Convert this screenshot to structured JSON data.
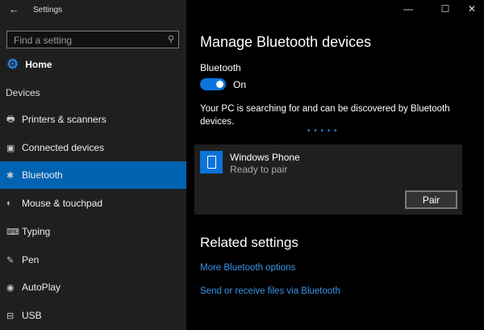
{
  "window": {
    "title": "Settings",
    "back": "←",
    "minimize": "—",
    "maximize": "☐",
    "close": "✕"
  },
  "sidebar": {
    "search_placeholder": "Find a setting",
    "home": "Home",
    "section": "Devices",
    "items": [
      {
        "label": "Printers & scanners",
        "icon": "🖶"
      },
      {
        "label": "Connected devices",
        "icon": "▣"
      },
      {
        "label": "Bluetooth",
        "icon": "✱"
      },
      {
        "label": "Mouse & touchpad",
        "icon": "◐"
      },
      {
        "label": "Typing",
        "icon": "⌨"
      },
      {
        "label": "Pen",
        "icon": "✎"
      },
      {
        "label": "AutoPlay",
        "icon": "◉"
      },
      {
        "label": "USB",
        "icon": "⊟"
      }
    ]
  },
  "main": {
    "title": "Manage Bluetooth devices",
    "bluetooth_label": "Bluetooth",
    "toggle_state": "On",
    "description": "Your PC is searching for and can be discovered by Bluetooth devices.",
    "progress": "• • • • •",
    "device": {
      "name": "Windows Phone",
      "status": "Ready to pair",
      "button": "Pair"
    },
    "related_title": "Related settings",
    "links": [
      "More Bluetooth options",
      "Send or receive files via Bluetooth"
    ]
  },
  "colors": {
    "accent": "#0063b1",
    "link": "#3a95e8"
  }
}
